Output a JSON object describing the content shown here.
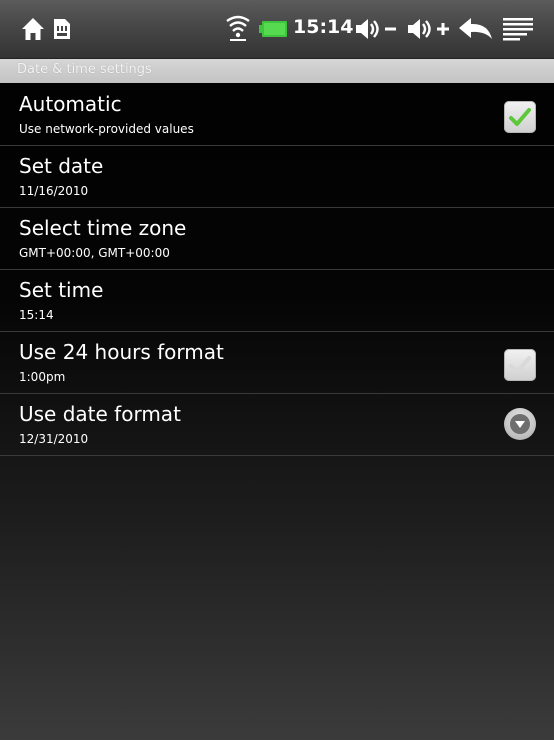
{
  "status_bar": {
    "time": "15:14",
    "icons": [
      "home-icon",
      "sd-card-icon",
      "wifi-icon",
      "battery-icon",
      "volume-down-icon",
      "volume-up-icon",
      "back-icon",
      "menu-icon"
    ],
    "battery_color": "#3ec43e"
  },
  "section_header": {
    "title": "Date & time settings"
  },
  "settings": [
    {
      "title": "Automatic",
      "summary": "Use network-provided values",
      "widget": "checkbox",
      "checked": true
    },
    {
      "title": "Set date",
      "summary": "11/16/2010",
      "widget": "none"
    },
    {
      "title": "Select time zone",
      "summary": "GMT+00:00, GMT+00:00",
      "widget": "none"
    },
    {
      "title": "Set time",
      "summary": "15:14",
      "widget": "none"
    },
    {
      "title": "Use 24 hours format",
      "summary": "1:00pm",
      "widget": "checkbox",
      "checked": false
    },
    {
      "title": "Use date format",
      "summary": "12/31/2010",
      "widget": "dropdown"
    }
  ],
  "colors": {
    "check_mark": "#5cc83a",
    "background_top": "#000000",
    "background_bottom": "#3b3b3b"
  }
}
